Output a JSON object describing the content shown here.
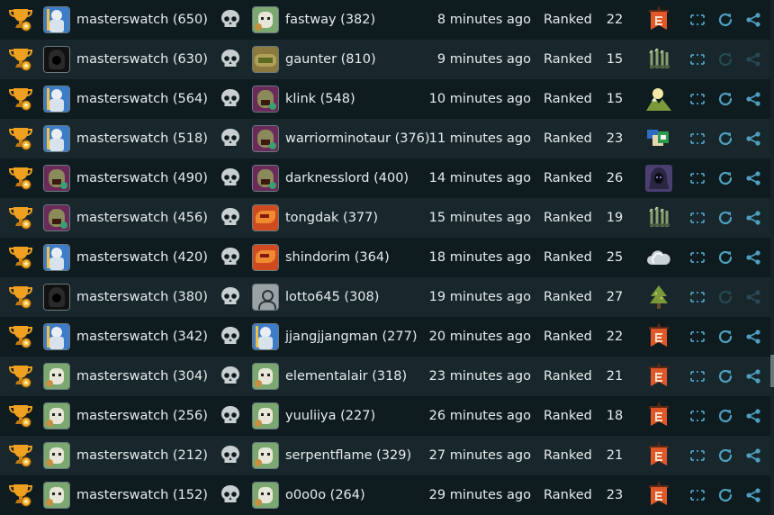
{
  "icons": {
    "trophy": "trophy-icon",
    "skull": "skull-icon",
    "map_vertical": "vertical-banner-map-icon",
    "map_swords": "swords-map-icon",
    "map_mountain": "mountain-map-icon",
    "map_cards": "cards-map-icon",
    "map_hooded": "hooded-figure-map-icon",
    "map_cloud": "cloud-map-icon",
    "map_tree": "tree-map-icon",
    "expand": "expand-icon",
    "replay": "replay-icon",
    "share": "share-icon"
  },
  "colors": {
    "row_odd": "#18272b",
    "row_even": "#0f1c1f",
    "accent": "#4f9fc0",
    "banner_orange": "#e0582a",
    "trophy_gold": "#f0a020"
  },
  "games": [
    {
      "player": "masterswatch (650)",
      "player_avatar": "wizard",
      "opponent": "fastway (382)",
      "opponent_avatar": "goblin",
      "time": "8 minutes ago",
      "mode": "Ranked",
      "turns": "22",
      "map": "banner",
      "replay_enabled": true
    },
    {
      "player": "masterswatch (630)",
      "player_avatar": "hood",
      "opponent": "gaunter (810)",
      "opponent_avatar": "beast",
      "time": "9 minutes ago",
      "mode": "Ranked",
      "turns": "15",
      "map": "swords",
      "replay_enabled": false
    },
    {
      "player": "masterswatch (564)",
      "player_avatar": "wizard",
      "opponent": "klink (548)",
      "opponent_avatar": "orc",
      "time": "10 minutes ago",
      "mode": "Ranked",
      "turns": "15",
      "map": "mountain",
      "replay_enabled": true
    },
    {
      "player": "masterswatch (518)",
      "player_avatar": "wizard",
      "opponent": "warriorminotaur (376)",
      "opponent_avatar": "orc",
      "time": "11 minutes ago",
      "mode": "Ranked",
      "turns": "23",
      "map": "cards",
      "replay_enabled": true
    },
    {
      "player": "masterswatch (490)",
      "player_avatar": "orc",
      "opponent": "darknesslord (400)",
      "opponent_avatar": "orc",
      "time": "14 minutes ago",
      "mode": "Ranked",
      "turns": "26",
      "map": "hooded",
      "replay_enabled": true
    },
    {
      "player": "masterswatch (456)",
      "player_avatar": "orc",
      "opponent": "tongdak (377)",
      "opponent_avatar": "dragon",
      "time": "15 minutes ago",
      "mode": "Ranked",
      "turns": "19",
      "map": "swords",
      "replay_enabled": true
    },
    {
      "player": "masterswatch (420)",
      "player_avatar": "wizard",
      "opponent": "shindorim (364)",
      "opponent_avatar": "dragon",
      "time": "18 minutes ago",
      "mode": "Ranked",
      "turns": "25",
      "map": "cloud",
      "replay_enabled": true
    },
    {
      "player": "masterswatch (380)",
      "player_avatar": "hood",
      "opponent": "lotto645 (308)",
      "opponent_avatar": "default",
      "time": "19 minutes ago",
      "mode": "Ranked",
      "turns": "27",
      "map": "tree",
      "replay_enabled": false
    },
    {
      "player": "masterswatch (342)",
      "player_avatar": "wizard",
      "opponent": "jjangjjangman (277)",
      "opponent_avatar": "wizard",
      "time": "20 minutes ago",
      "mode": "Ranked",
      "turns": "22",
      "map": "banner",
      "replay_enabled": true
    },
    {
      "player": "masterswatch (304)",
      "player_avatar": "goblin",
      "opponent": "elementalair (318)",
      "opponent_avatar": "goblin",
      "time": "23 minutes ago",
      "mode": "Ranked",
      "turns": "21",
      "map": "banner",
      "replay_enabled": true
    },
    {
      "player": "masterswatch (256)",
      "player_avatar": "goblin",
      "opponent": "yuuliiya (227)",
      "opponent_avatar": "goblin",
      "time": "26 minutes ago",
      "mode": "Ranked",
      "turns": "18",
      "map": "banner",
      "replay_enabled": true
    },
    {
      "player": "masterswatch (212)",
      "player_avatar": "goblin",
      "opponent": "serpentflame (329)",
      "opponent_avatar": "goblin",
      "time": "27 minutes ago",
      "mode": "Ranked",
      "turns": "21",
      "map": "banner",
      "replay_enabled": true
    },
    {
      "player": "masterswatch (152)",
      "player_avatar": "goblin",
      "opponent": "o0o0o (264)",
      "opponent_avatar": "goblin",
      "time": "29 minutes ago",
      "mode": "Ranked",
      "turns": "23",
      "map": "banner",
      "replay_enabled": true
    }
  ]
}
